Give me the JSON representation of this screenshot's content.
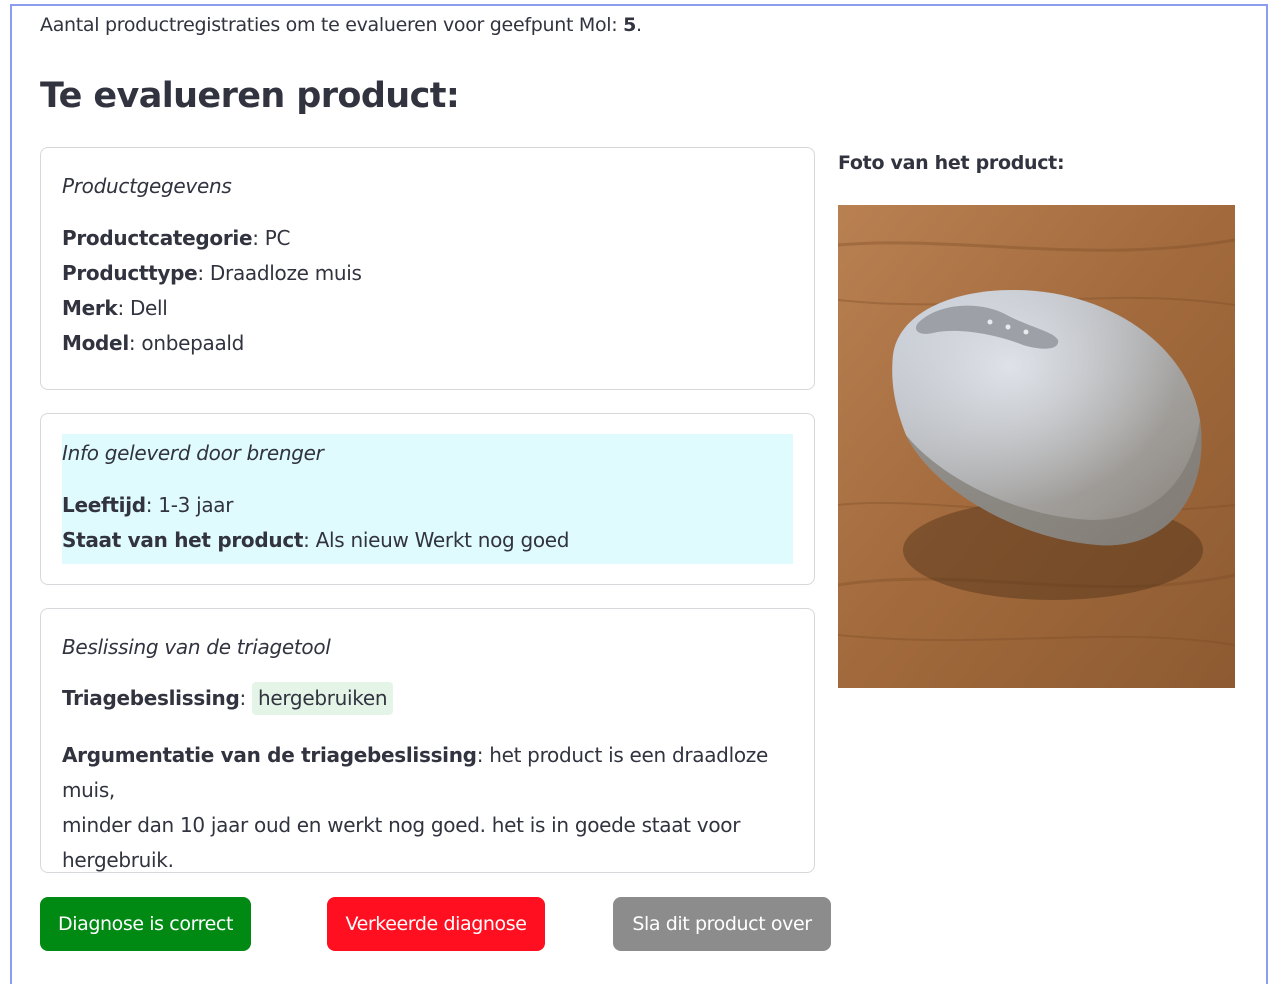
{
  "header": {
    "count_text": "Aantal productregistraties om te evalueren voor geefpunt Mol: ",
    "count_value": "5",
    "count_suffix": ".",
    "title": "Te evalueren product:"
  },
  "product_card": {
    "heading": "Productgegevens",
    "fields": [
      {
        "label": "Productcategorie",
        "value": "PC"
      },
      {
        "label": "Producttype",
        "value": "Draadloze muis"
      },
      {
        "label": "Merk",
        "value": "Dell"
      },
      {
        "label": "Model",
        "value": "onbepaald"
      }
    ]
  },
  "info_card": {
    "heading": "Info geleverd door brenger",
    "fields": [
      {
        "label": "Leeftijd",
        "value": "1-3 jaar"
      },
      {
        "label": "Staat van het product",
        "value": "Als nieuw Werkt nog goed"
      }
    ]
  },
  "decision_card": {
    "heading": "Beslissing van de triagetool",
    "decision_label": "Triagebeslissing",
    "decision_value": "hergebruiken",
    "argument_label": "Argumentatie van de triagebeslissing",
    "argument_line1": "het product is een draadloze muis,",
    "argument_line2": "minder dan 10 jaar oud en werkt nog goed. het is in goede staat voor",
    "argument_line3": "hergebruik."
  },
  "photo": {
    "label": "Foto van het product:",
    "subject": "wireless-mouse-photo"
  },
  "buttons": {
    "correct": "Diagnose is correct",
    "wrong": "Verkeerde diagnose",
    "skip": "Sla dit product over"
  },
  "colors": {
    "correct": "#008a14",
    "wrong": "#ff0f1f",
    "skip": "#8c8c8c",
    "info_bg": "#e0fbfe",
    "badge_bg": "#e4f5e8",
    "frame": "#8c9df0"
  }
}
